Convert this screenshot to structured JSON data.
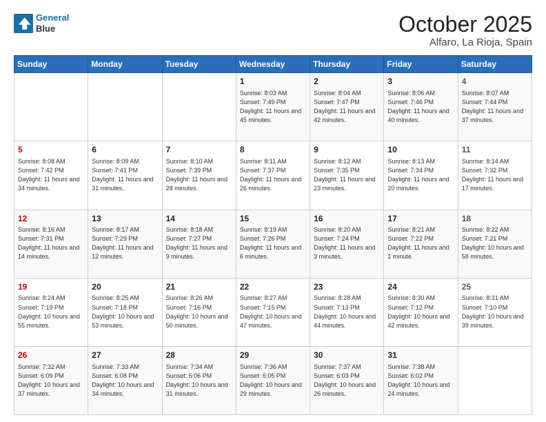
{
  "header": {
    "logo_line1": "General",
    "logo_line2": "Blue",
    "month_title": "October 2025",
    "location": "Alfaro, La Rioja, Spain"
  },
  "days_of_week": [
    "Sunday",
    "Monday",
    "Tuesday",
    "Wednesday",
    "Thursday",
    "Friday",
    "Saturday"
  ],
  "weeks": [
    {
      "cells": [
        {
          "day": null
        },
        {
          "day": null
        },
        {
          "day": null
        },
        {
          "day": "1",
          "sunrise": "8:03 AM",
          "sunset": "7:49 PM",
          "daylight": "11 hours and 45 minutes."
        },
        {
          "day": "2",
          "sunrise": "8:04 AM",
          "sunset": "7:47 PM",
          "daylight": "11 hours and 42 minutes."
        },
        {
          "day": "3",
          "sunrise": "8:06 AM",
          "sunset": "7:46 PM",
          "daylight": "11 hours and 40 minutes."
        },
        {
          "day": "4",
          "sunrise": "8:07 AM",
          "sunset": "7:44 PM",
          "daylight": "11 hours and 37 minutes."
        }
      ]
    },
    {
      "cells": [
        {
          "day": "5",
          "sunrise": "8:08 AM",
          "sunset": "7:42 PM",
          "daylight": "11 hours and 34 minutes."
        },
        {
          "day": "6",
          "sunrise": "8:09 AM",
          "sunset": "7:41 PM",
          "daylight": "11 hours and 31 minutes."
        },
        {
          "day": "7",
          "sunrise": "8:10 AM",
          "sunset": "7:39 PM",
          "daylight": "11 hours and 28 minutes."
        },
        {
          "day": "8",
          "sunrise": "8:11 AM",
          "sunset": "7:37 PM",
          "daylight": "11 hours and 26 minutes."
        },
        {
          "day": "9",
          "sunrise": "8:12 AM",
          "sunset": "7:35 PM",
          "daylight": "11 hours and 23 minutes."
        },
        {
          "day": "10",
          "sunrise": "8:13 AM",
          "sunset": "7:34 PM",
          "daylight": "11 hours and 20 minutes."
        },
        {
          "day": "11",
          "sunrise": "8:14 AM",
          "sunset": "7:32 PM",
          "daylight": "11 hours and 17 minutes."
        }
      ]
    },
    {
      "cells": [
        {
          "day": "12",
          "sunrise": "8:16 AM",
          "sunset": "7:31 PM",
          "daylight": "11 hours and 14 minutes."
        },
        {
          "day": "13",
          "sunrise": "8:17 AM",
          "sunset": "7:29 PM",
          "daylight": "11 hours and 12 minutes."
        },
        {
          "day": "14",
          "sunrise": "8:18 AM",
          "sunset": "7:27 PM",
          "daylight": "11 hours and 9 minutes."
        },
        {
          "day": "15",
          "sunrise": "8:19 AM",
          "sunset": "7:26 PM",
          "daylight": "11 hours and 6 minutes."
        },
        {
          "day": "16",
          "sunrise": "8:20 AM",
          "sunset": "7:24 PM",
          "daylight": "11 hours and 3 minutes."
        },
        {
          "day": "17",
          "sunrise": "8:21 AM",
          "sunset": "7:22 PM",
          "daylight": "11 hours and 1 minute."
        },
        {
          "day": "18",
          "sunrise": "8:22 AM",
          "sunset": "7:21 PM",
          "daylight": "10 hours and 58 minutes."
        }
      ]
    },
    {
      "cells": [
        {
          "day": "19",
          "sunrise": "8:24 AM",
          "sunset": "7:19 PM",
          "daylight": "10 hours and 55 minutes."
        },
        {
          "day": "20",
          "sunrise": "8:25 AM",
          "sunset": "7:18 PM",
          "daylight": "10 hours and 53 minutes."
        },
        {
          "day": "21",
          "sunrise": "8:26 AM",
          "sunset": "7:16 PM",
          "daylight": "10 hours and 50 minutes."
        },
        {
          "day": "22",
          "sunrise": "8:27 AM",
          "sunset": "7:15 PM",
          "daylight": "10 hours and 47 minutes."
        },
        {
          "day": "23",
          "sunrise": "8:28 AM",
          "sunset": "7:13 PM",
          "daylight": "10 hours and 44 minutes."
        },
        {
          "day": "24",
          "sunrise": "8:30 AM",
          "sunset": "7:12 PM",
          "daylight": "10 hours and 42 minutes."
        },
        {
          "day": "25",
          "sunrise": "8:31 AM",
          "sunset": "7:10 PM",
          "daylight": "10 hours and 39 minutes."
        }
      ]
    },
    {
      "cells": [
        {
          "day": "26",
          "sunrise": "7:32 AM",
          "sunset": "6:09 PM",
          "daylight": "10 hours and 37 minutes."
        },
        {
          "day": "27",
          "sunrise": "7:33 AM",
          "sunset": "6:08 PM",
          "daylight": "10 hours and 34 minutes."
        },
        {
          "day": "28",
          "sunrise": "7:34 AM",
          "sunset": "6:06 PM",
          "daylight": "10 hours and 31 minutes."
        },
        {
          "day": "29",
          "sunrise": "7:36 AM",
          "sunset": "6:05 PM",
          "daylight": "10 hours and 29 minutes."
        },
        {
          "day": "30",
          "sunrise": "7:37 AM",
          "sunset": "6:03 PM",
          "daylight": "10 hours and 26 minutes."
        },
        {
          "day": "31",
          "sunrise": "7:38 AM",
          "sunset": "6:02 PM",
          "daylight": "10 hours and 24 minutes."
        },
        {
          "day": null
        }
      ]
    }
  ]
}
